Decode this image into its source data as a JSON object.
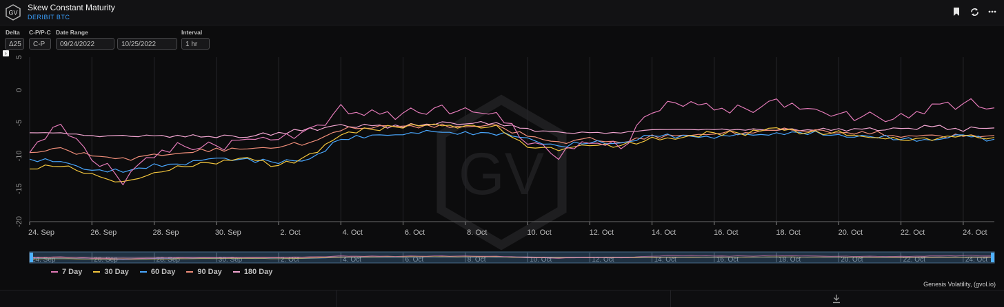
{
  "header": {
    "logo_text": "GV",
    "title": "Skew Constant Maturity",
    "subtitle": "DERIBIT BTC",
    "icons": [
      "bookmark-icon",
      "refresh-icon",
      "more-icon"
    ]
  },
  "controls": {
    "delta": {
      "label": "Delta",
      "value": "Δ25"
    },
    "cp": {
      "label": "C-P/P-C",
      "value": "C-P"
    },
    "date_range": {
      "label": "Date Range",
      "start": "09/24/2022",
      "end": "10/25/2022"
    },
    "interval": {
      "label": "Interval",
      "value": "1 hr"
    }
  },
  "chart_data": {
    "type": "line",
    "title": "Skew Constant Maturity",
    "ylim": [
      -20,
      5
    ],
    "yticks": [
      "5",
      "0",
      "-5",
      "-10",
      "-15",
      "-20"
    ],
    "xlim": [
      "2022-09-24",
      "2022-10-25"
    ],
    "xticks": [
      "24. Sep",
      "26. Sep",
      "28. Sep",
      "30. Sep",
      "2. Oct",
      "4. Oct",
      "6. Oct",
      "8. Oct",
      "10. Oct",
      "12. Oct",
      "14. Oct",
      "16. Oct",
      "18. Oct",
      "20. Oct",
      "22. Oct",
      "24. Oct"
    ],
    "grid": "vertical",
    "legend_position": "bottom-left",
    "watermark": "GV",
    "x": [
      "2022-09-24",
      "2022-09-25",
      "2022-09-26",
      "2022-09-27",
      "2022-09-28",
      "2022-09-29",
      "2022-09-30",
      "2022-10-01",
      "2022-10-02",
      "2022-10-03",
      "2022-10-04",
      "2022-10-05",
      "2022-10-06",
      "2022-10-07",
      "2022-10-08",
      "2022-10-09",
      "2022-10-10",
      "2022-10-11",
      "2022-10-12",
      "2022-10-13",
      "2022-10-14",
      "2022-10-15",
      "2022-10-16",
      "2022-10-17",
      "2022-10-18",
      "2022-10-19",
      "2022-10-20",
      "2022-10-21",
      "2022-10-22",
      "2022-10-23",
      "2022-10-24",
      "2022-10-25"
    ],
    "series": [
      {
        "name": "7 Day",
        "color": "#e37ab8",
        "values": [
          -9.5,
          -5.5,
          -10.5,
          -13.5,
          -9.5,
          -8.5,
          -8.5,
          -7,
          -7,
          -6,
          -3,
          -3.5,
          -3.5,
          -3,
          -3.5,
          -4,
          -8,
          -10,
          -8,
          -9,
          -3,
          -1.5,
          -2.5,
          -3,
          -1.5,
          -2.5,
          -3.5,
          -4,
          -4.5,
          -2.5,
          -2,
          -3
        ]
      },
      {
        "name": "30 Day",
        "color": "#f2c53d",
        "values": [
          -12,
          -11.5,
          -13,
          -14,
          -12.5,
          -11.5,
          -11,
          -10.5,
          -11.5,
          -10,
          -6.5,
          -6,
          -5.5,
          -5.5,
          -5.5,
          -5.5,
          -8.5,
          -9,
          -8.5,
          -8.5,
          -7.5,
          -7,
          -6.5,
          -6.5,
          -6,
          -6.5,
          -6.5,
          -7,
          -7.5,
          -7.5,
          -7,
          -7.5
        ]
      },
      {
        "name": "60 Day",
        "color": "#4aa8ff",
        "values": [
          -10.5,
          -11,
          -12,
          -12.5,
          -11.5,
          -11,
          -10.5,
          -10.5,
          -11,
          -10.5,
          -7.5,
          -7,
          -6.5,
          -6.5,
          -6.5,
          -6.5,
          -7.5,
          -8.5,
          -8,
          -8,
          -7,
          -7,
          -7,
          -7,
          -6.5,
          -6.5,
          -7,
          -7,
          -7.5,
          -7.5,
          -7,
          -7.5
        ]
      },
      {
        "name": "90 Day",
        "color": "#f08e7a",
        "values": [
          -9.5,
          -9,
          -10,
          -10.5,
          -10,
          -9.5,
          -9,
          -9,
          -8.5,
          -8,
          -6,
          -5.5,
          -5.5,
          -5.5,
          -5.5,
          -5.5,
          -7,
          -8,
          -7.5,
          -8,
          -7,
          -7,
          -6.5,
          -6.5,
          -6,
          -6,
          -6.5,
          -6.5,
          -7,
          -7,
          -7,
          -7
        ]
      },
      {
        "name": "180 Day",
        "color": "#f3a6d2",
        "values": [
          -6.5,
          -6.5,
          -7,
          -7,
          -7,
          -7,
          -7,
          -7,
          -6.5,
          -6,
          -5.5,
          -5.5,
          -5.5,
          -5,
          -5,
          -5,
          -6,
          -6.5,
          -6.5,
          -6.5,
          -6,
          -6,
          -6,
          -6,
          -6,
          -6,
          -6,
          -6,
          -6,
          -5.5,
          -6,
          -5.5
        ]
      }
    ]
  },
  "credit": "Genesis Volatility, (gvol.io)",
  "footer": {
    "download_icon": "download-icon"
  }
}
